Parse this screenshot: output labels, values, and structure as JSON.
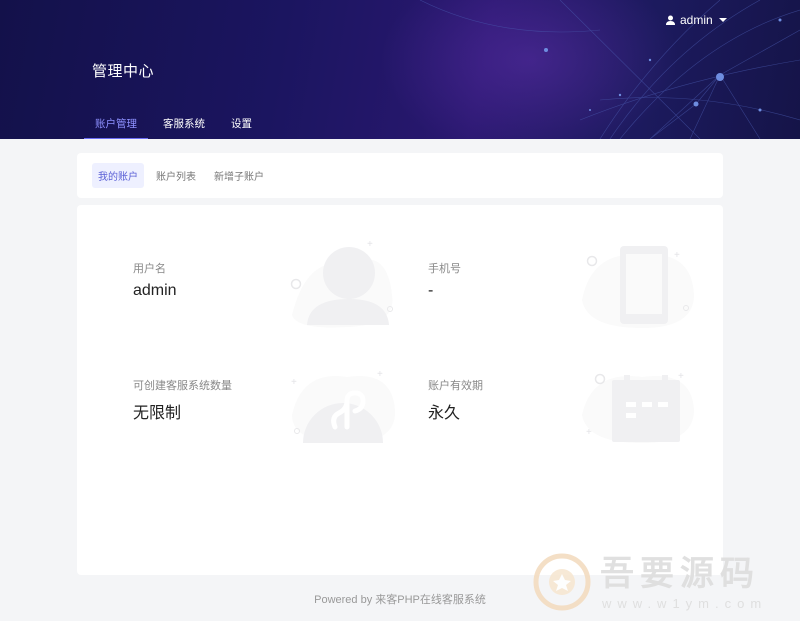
{
  "header": {
    "title": "管理中心",
    "user": {
      "name": "admin",
      "icon": "user-icon"
    },
    "tabs": [
      {
        "label": "账户管理",
        "active": true
      },
      {
        "label": "客服系统",
        "active": false
      },
      {
        "label": "设置",
        "active": false
      }
    ]
  },
  "subtabs": [
    {
      "label": "我的账户",
      "active": true
    },
    {
      "label": "账户列表",
      "active": false
    },
    {
      "label": "新增子账户",
      "active": false
    }
  ],
  "account": {
    "username": {
      "label": "用户名",
      "value": "admin"
    },
    "phone": {
      "label": "手机号",
      "value": "-"
    },
    "quota": {
      "label": "可创建客服系统数量",
      "value": "无限制"
    },
    "validity": {
      "label": "账户有效期",
      "value": "永久"
    }
  },
  "footer": {
    "text": "Powered by 来客PHP在线客服系统"
  },
  "watermark": {
    "text": "吾要源码",
    "url": "www.w1ym.com"
  },
  "colors": {
    "accent": "#6b6df5",
    "header_bg": "#1b1560"
  }
}
